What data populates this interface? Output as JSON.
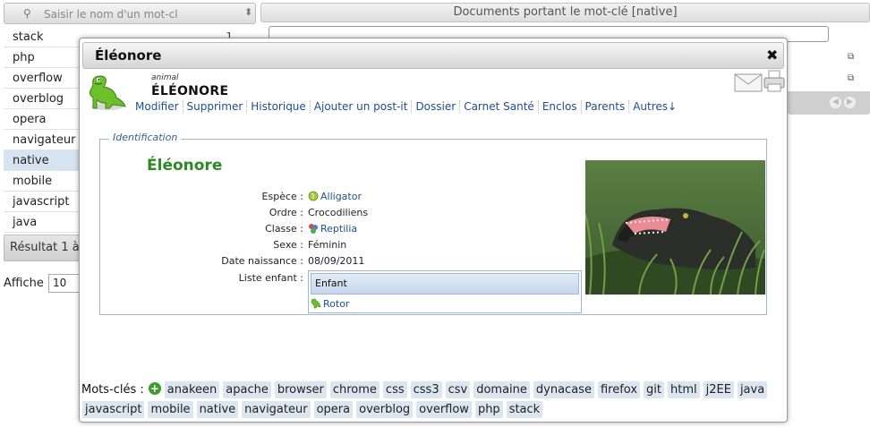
{
  "search": {
    "placeholder": "Saisir le nom d'un mot-clé"
  },
  "tag_list": [
    {
      "label": "stack",
      "count": "1"
    },
    {
      "label": "php",
      "count": ""
    },
    {
      "label": "overflow",
      "count": ""
    },
    {
      "label": "overblog",
      "count": ""
    },
    {
      "label": "opera",
      "count": ""
    },
    {
      "label": "navigateur",
      "count": ""
    },
    {
      "label": "native",
      "count": "",
      "selected": true
    },
    {
      "label": "mobile",
      "count": ""
    },
    {
      "label": "javascript",
      "count": ""
    },
    {
      "label": "java",
      "count": ""
    }
  ],
  "result_text": "Résultat 1 à",
  "affiche": {
    "label": "Affiche",
    "value": "10"
  },
  "doc_panel": {
    "title": "Documents portant le mot-clé [native]"
  },
  "dialog": {
    "title": "Éléonore",
    "family_type": "animal",
    "family_name": "ÉLÉONORE",
    "menu": [
      "Modifier",
      "Supprimer",
      "Historique",
      "Ajouter un post-it",
      "Dossier",
      "Carnet Santé",
      "Enclos",
      "Parents",
      "Autres↓"
    ],
    "section_legend": "Identification",
    "name": "Éléonore",
    "fields": [
      {
        "label": "Espèce :",
        "value": "Alligator",
        "link": true,
        "icon": "species-icon"
      },
      {
        "label": "Ordre :",
        "value": "Crocodiliens",
        "link": false
      },
      {
        "label": "Classe :",
        "value": "Reptilia",
        "link": true,
        "icon": "class-icon"
      },
      {
        "label": "Sexe :",
        "value": "Féminin",
        "link": false
      },
      {
        "label": "Date naissance :",
        "value": "08/09/2011",
        "link": false
      }
    ],
    "children_label": "Liste enfant :",
    "children_header": "Enfant",
    "children": [
      "Rotor"
    ],
    "close_symbol": "✖",
    "keywords_label": "Mots-clés :",
    "keywords": [
      "anakeen",
      "apache",
      "browser",
      "chrome",
      "css",
      "css3",
      "csv",
      "domaine",
      "dynacase",
      "firefox",
      "git",
      "html",
      "j2EE",
      "java",
      "javascript",
      "mobile",
      "native",
      "navigateur",
      "opera",
      "overblog",
      "overflow",
      "php",
      "stack"
    ]
  },
  "colors": {
    "accent": "#2c8a25",
    "link": "#1f4e8c",
    "selected_row": "#d6e3f1",
    "keyword_bg": "#dbe6f1"
  }
}
